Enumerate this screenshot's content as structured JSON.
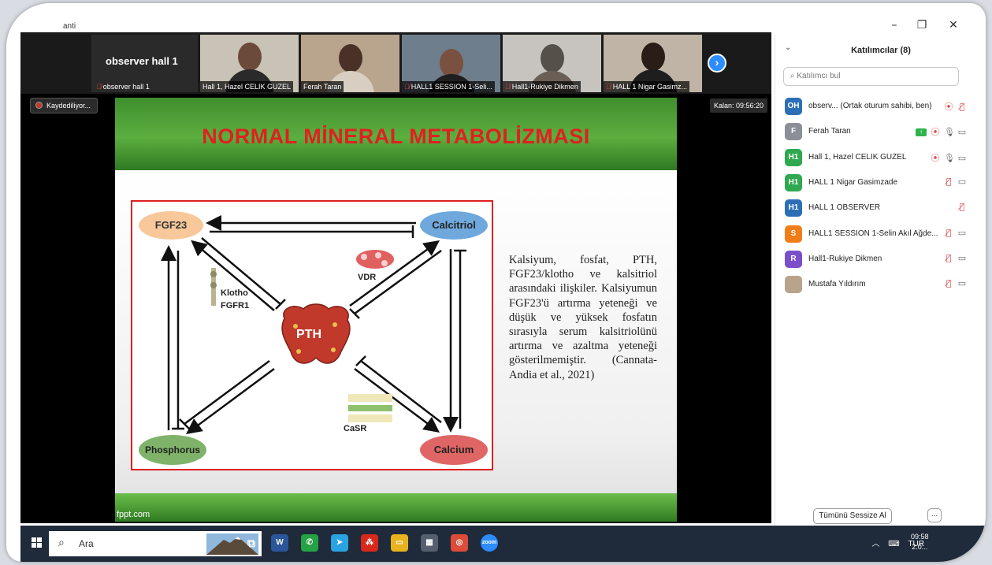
{
  "window": {
    "title": "anti"
  },
  "thumbnails": {
    "observer": {
      "name": "observer hall 1",
      "label": "observer hall 1"
    },
    "tiles": [
      {
        "label": "Hall 1, Hazel CELIK GUZEL",
        "muted": false
      },
      {
        "label": "Ferah Taran",
        "muted": false
      },
      {
        "label": "HALL1 SESSION 1-Seli...",
        "muted": true
      },
      {
        "label": "Hall1-Rukiye Dikmen",
        "muted": true
      },
      {
        "label": "HALL 1  Nigar Gasimz...",
        "muted": true
      }
    ]
  },
  "recording": {
    "label": "Kaydediliyor..."
  },
  "remaining": {
    "label": "Kalan: 09:56:20"
  },
  "slide": {
    "title": "NORMAL MİNERAL METABOLİZMASI",
    "footer": "fppt.com",
    "diagram": {
      "fgf23": "FGF23",
      "calcitriol": "Calcitriol",
      "pth": "PTH",
      "phosphorus": "Phosphorus",
      "calcium": "Calcium",
      "klotho": "Klotho",
      "fgfr1": "FGFR1",
      "vdr": "VDR",
      "casr": "CaSR"
    },
    "text": "Kalsiyum, fosfat, PTH, FGF23/klotho ve kalsitriol arasındaki ilişkiler. Kalsiyumun FGF23'ü artırma yeteneği ve düşük ve yüksek fosfatın sırasıyla serum kalsitriolünü artırma ve azaltma yeteneği gösterilmemiştir. (Cannata-Andia et al., 2021)"
  },
  "participants_panel": {
    "title": "Katılımcılar (8)",
    "search_placeholder": "Katılımcı bul",
    "mute_all": "Tümünü Sessize Al",
    "more": "...",
    "participants": [
      {
        "initials": "OH",
        "name": "observ...  (Ortak oturum sahibi, ben)",
        "color": "#2c6fb7",
        "icons": [
          "rec",
          "mute"
        ]
      },
      {
        "initials": "F",
        "name": "Ferah Taran",
        "color": "#8a8f98",
        "icons": [
          "share",
          "rec",
          "mic",
          "cam"
        ]
      },
      {
        "initials": "H1",
        "name": "Hall 1, Hazel CELIK GUZEL",
        "color": "#2fa84f",
        "icons": [
          "rec",
          "mic",
          "cam"
        ]
      },
      {
        "initials": "H1",
        "name": "HALL 1  Nigar Gasimzade",
        "color": "#2fa84f",
        "icons": [
          "mute",
          "cam"
        ]
      },
      {
        "initials": "H1",
        "name": "HALL 1 OBSERVER",
        "color": "#2c6fb7",
        "icons": [
          "mute"
        ]
      },
      {
        "initials": "S",
        "name": "HALL1 SESSION 1-Selin Akıl Ağde...",
        "color": "#f07d1a",
        "icons": [
          "mute",
          "cam"
        ]
      },
      {
        "initials": "R",
        "name": "Hall1-Rukiye Dikmen",
        "color": "#7b4fc9",
        "icons": [
          "mute",
          "cam"
        ]
      },
      {
        "initials": "",
        "name": "Mustafa Yıldırım",
        "color": "#b8a48a",
        "icons": [
          "mute",
          "cam"
        ]
      }
    ]
  },
  "taskbar": {
    "search_text": "Ara",
    "apps": [
      {
        "name": "task-view",
        "glyph": "⧉",
        "color": "transparent"
      },
      {
        "name": "word",
        "glyph": "W",
        "color": "#2b579a"
      },
      {
        "name": "whatsapp",
        "glyph": "✆",
        "color": "#25a244"
      },
      {
        "name": "telegram",
        "glyph": "➤",
        "color": "#2aa3e0"
      },
      {
        "name": "pdf",
        "glyph": "⁂",
        "color": "#d8281c"
      },
      {
        "name": "explorer",
        "glyph": "▭",
        "color": "#e9b21f"
      },
      {
        "name": "calculator",
        "glyph": "▦",
        "color": "#555f6e"
      },
      {
        "name": "chrome",
        "glyph": "◎",
        "color": "#dd4b39"
      },
      {
        "name": "zoom",
        "glyph": "zoom",
        "color": "#2d8cff"
      }
    ],
    "language": "TUR",
    "time": "09:58",
    "date": "2.0..."
  }
}
